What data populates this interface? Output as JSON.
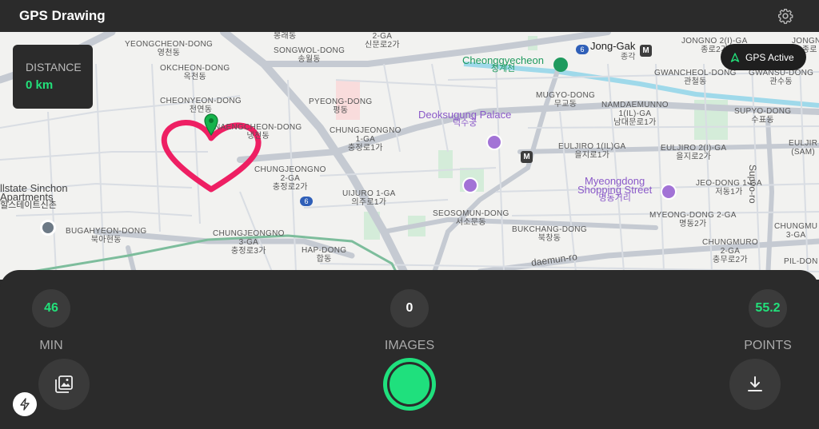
{
  "app": {
    "title": "GPS Drawing"
  },
  "map": {
    "labels": {
      "yeongcheon": [
        "YEONGCHEON-DONG",
        "영천동"
      ],
      "okcheon": [
        "OKCHEON-DONG",
        "옥천동"
      ],
      "cheonyeon": [
        "CHEONYEON-DONG",
        "천연동"
      ],
      "naengcheon": [
        "NAENGCHEON-DONG",
        "냉천동"
      ],
      "songwol": [
        "SONGWOL-DONG",
        "송월동"
      ],
      "pyeong": [
        "PYEONG-DONG",
        "평동"
      ],
      "chungjeongno1": [
        "CHUNGJEONGNO",
        "1-GA",
        "충정로1가"
      ],
      "chungjeongno2": [
        "CHUNGJEONGNO",
        "2-GA",
        "충정로2가"
      ],
      "chungjeongno3": [
        "CHUNGJEONGNO",
        "3-GA",
        "충정로3가"
      ],
      "uijuro": [
        "UIJURO 1-GA",
        "의주로1가"
      ],
      "seosomun": [
        "SEOSOMUN-DONG",
        "서소문동"
      ],
      "bugahyeon": [
        "BUGAHYEON-DONG",
        "북아현동"
      ],
      "hap": [
        "HAP-DONG",
        "합동"
      ],
      "sinmunro": [
        "2-GA",
        "신문로2가"
      ],
      "mugyo": [
        "MUGYO-DONG",
        "무교동"
      ],
      "bukchang": [
        "BUKCHANG-DONG",
        "북창동"
      ],
      "namdaemunno": [
        "NAMDAEMUNNO",
        "1(IL)-GA",
        "남대문로1가"
      ],
      "euljiro1": [
        "EULJIRO 1(IL)GA",
        "을지로1가"
      ],
      "euljiro2": [
        "EULJIRO 2(I)-GA",
        "을지로2가"
      ],
      "jongno2": [
        "JONGNO 2(I)-GA",
        "종로2가"
      ],
      "gwancheol": [
        "GWANCHEOL-DONG",
        "관철동"
      ],
      "gwansu": [
        "GWANSU-DONG",
        "관수동"
      ],
      "supyo": [
        "SUPYO-DONG",
        "수표동"
      ],
      "jeo": [
        "JEO-DONG 1-GA",
        "저동1가"
      ],
      "myeong2": [
        "MYEONG-DONG 2-GA",
        "명동2가"
      ],
      "chungmuro": [
        "CHUNGMURO",
        "2-GA",
        "충무로2가"
      ],
      "chungmu_r": [
        "CHUNGMU",
        "3-GA"
      ],
      "pil": [
        "PIL-DON"
      ],
      "euljiro_r": [
        "EULJIR",
        "(SAM)"
      ],
      "jongno_r": [
        "JONGNO",
        "종로"
      ],
      "bongrae": [
        "봉래동"
      ]
    },
    "poi": {
      "cheonggyecheon": [
        "Cheonggyecheon",
        "청계천"
      ],
      "deoksugung": [
        "Deoksugung Palace",
        "덕수궁"
      ],
      "myeongdong": [
        "Myeongdong",
        "Shopping Street",
        "명동거리"
      ],
      "hillstate": [
        "llstate Sinchon",
        "Apartments",
        "힐스테이트신촌"
      ]
    },
    "roads": {
      "jonggak": "Jong-Gak",
      "jonggak_kr": "종각",
      "supyo_ro": "Supyo-ro",
      "daemun_ro": "daemun-ro",
      "route6": "6"
    }
  },
  "distance": {
    "label": "DISTANCE",
    "value": "0 km"
  },
  "gps": {
    "status": "GPS Active"
  },
  "stats": {
    "min": {
      "value": "46",
      "label": "MIN"
    },
    "images": {
      "value": "0",
      "label": "IMAGES"
    },
    "points": {
      "value": "55.2",
      "label": "POINTS"
    }
  },
  "icons": {
    "settings": "gear-icon",
    "gallery": "gallery-icon",
    "download": "download-icon",
    "flash": "flash-icon",
    "pin": "location-pin-icon",
    "gps": "navigation-arrow-icon"
  },
  "colors": {
    "accent": "#22e07a",
    "record": "#1fe07d",
    "drawing": "#ee1f63",
    "panel": "#2b2b2b"
  }
}
